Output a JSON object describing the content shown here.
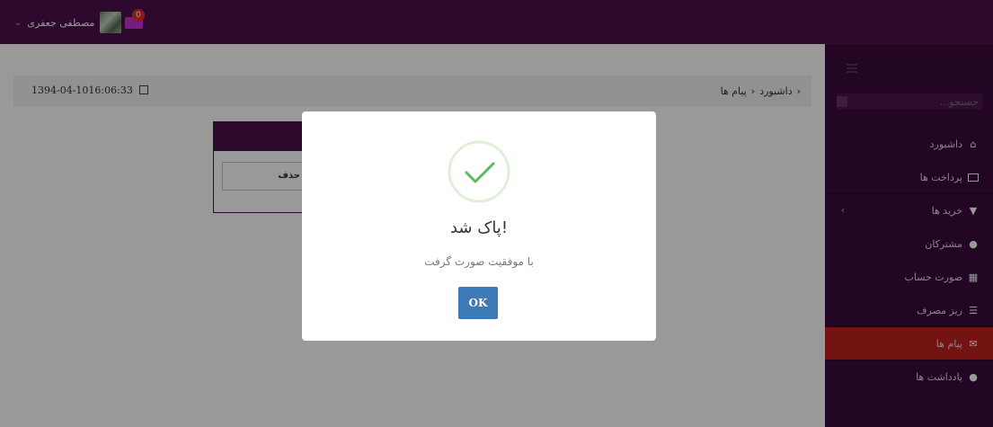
{
  "header": {
    "user_name": "مصطفی جعفری",
    "notification_count": "0"
  },
  "sidebar": {
    "search_placeholder": "جستجو...",
    "items": [
      {
        "label": "داشبورد",
        "icon": "home-icon"
      },
      {
        "label": "پرداخت ها",
        "icon": "credit-card-icon"
      },
      {
        "label": "خرید ها",
        "icon": "cart-icon",
        "has_submenu": true
      },
      {
        "label": "مشترکان",
        "icon": "user-icon"
      },
      {
        "label": "صورت حساب",
        "icon": "invoice-icon"
      },
      {
        "label": "ریز مصرف",
        "icon": "list-icon"
      },
      {
        "label": "پیام ها",
        "icon": "envelope-icon",
        "active": true
      },
      {
        "label": "یادداشت ها",
        "icon": "comment-icon"
      }
    ],
    "active_color": "#c0201f"
  },
  "breadcrumb": {
    "items": [
      "داشبورد",
      "پیام ها"
    ],
    "datetime": "1394-04-1016:06:33"
  },
  "panel": {
    "delete_label": "حذف"
  },
  "modal": {
    "title": "پاک شد!",
    "message": "با موفقیت صورت گرفت",
    "ok_label": "OK",
    "success_color": "#5cb85c"
  },
  "colors": {
    "brand": "#4a0f4b",
    "sidebar": "#3a0b3c",
    "button": "#3c7ab8"
  }
}
